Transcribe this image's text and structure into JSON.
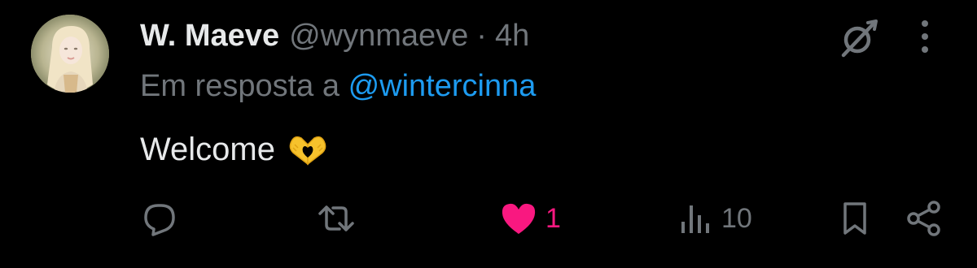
{
  "author": {
    "display_name": "W. Maeve",
    "handle": "@wynmaeve",
    "separator": "·",
    "time_ago": "4h"
  },
  "reply_context": {
    "prefix": "Em resposta a",
    "mention": "@wintercinna"
  },
  "post": {
    "text": "Welcome",
    "emoji": "heart-hands-emoji"
  },
  "actions": {
    "reply": {
      "icon": "reply-icon"
    },
    "repost": {
      "icon": "repost-icon"
    },
    "like": {
      "icon": "heart-filled-icon",
      "count": "1",
      "liked": true
    },
    "views": {
      "icon": "views-icon",
      "count": "10"
    },
    "bookmark": {
      "icon": "bookmark-icon"
    },
    "share": {
      "icon": "share-icon"
    }
  },
  "top_right": {
    "grok": {
      "icon": "grok-icon"
    },
    "more": {
      "icon": "more-vertical-icon"
    }
  },
  "colors": {
    "background": "#000000",
    "primary_text": "#e7e9ea",
    "secondary_text": "#71767b",
    "mention": "#1d9bf0",
    "like": "#f91880"
  }
}
